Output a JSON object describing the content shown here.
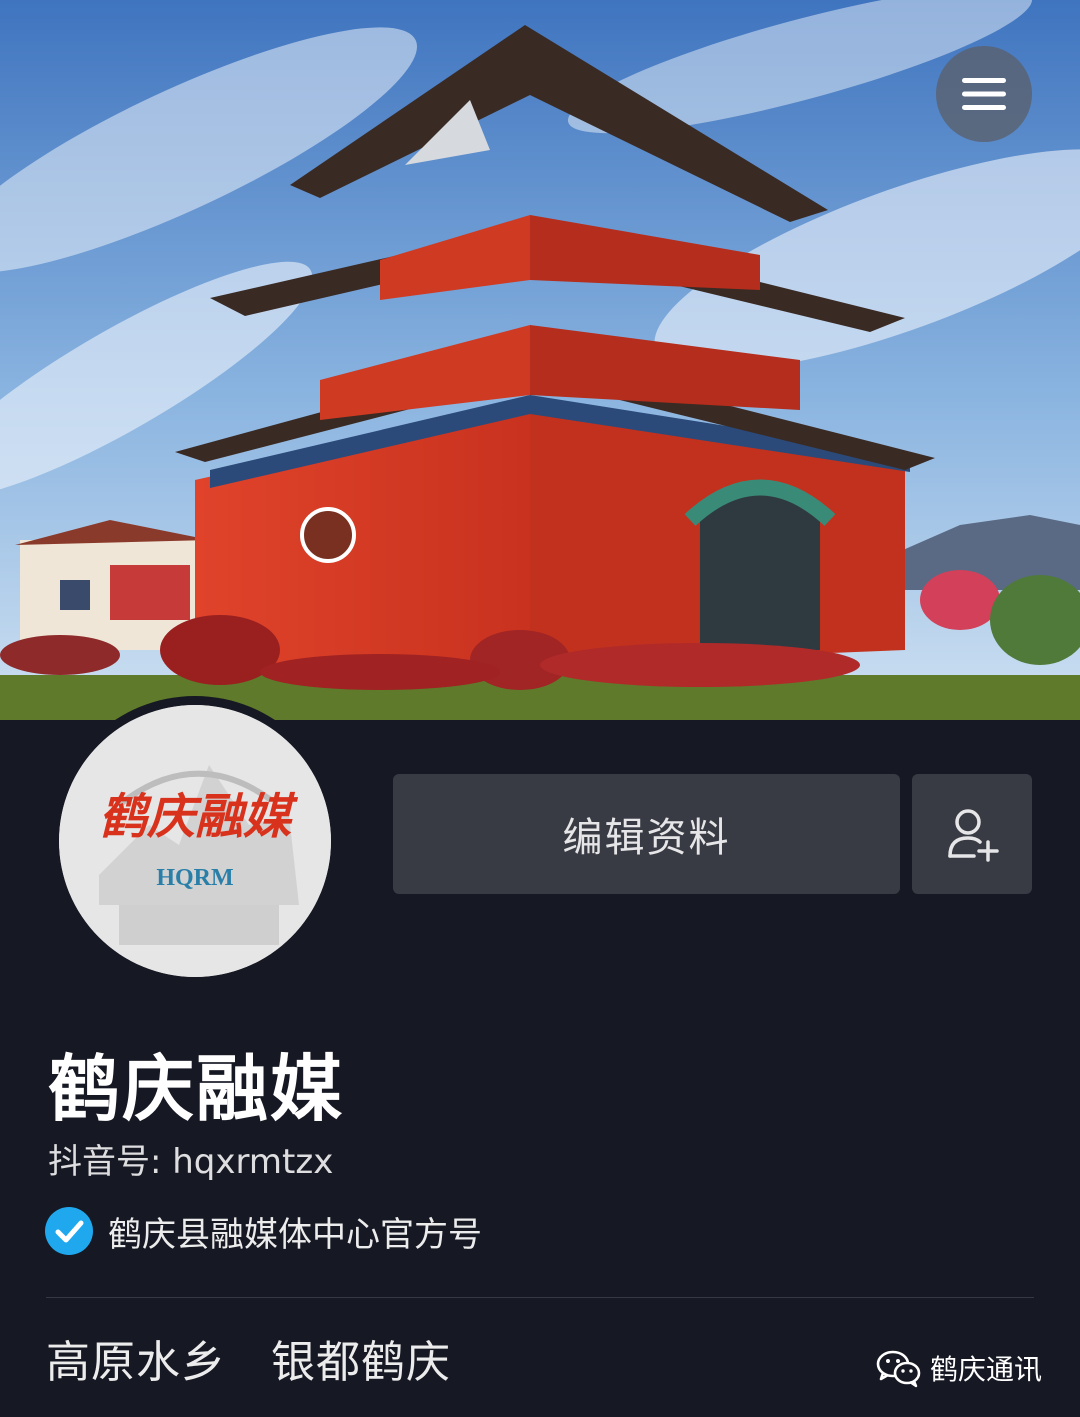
{
  "header": {
    "cover_image": "bell-tower-photo",
    "menu_icon": "hamburger-menu-icon"
  },
  "profile": {
    "avatar_logo_text": "鹤庆融媒",
    "avatar_logo_sub": "HQRM",
    "edit_button_label": "编辑资料",
    "add_friend_icon": "add-friend-icon",
    "name": "鹤庆融媒",
    "douyin_id": "抖音号: hqxrmtzx",
    "verified_text": "鹤庆县融媒体中心官方号",
    "bio": "高原水乡　银都鹤庆"
  },
  "watermark": {
    "icon": "wechat-icon",
    "text": "鹤庆通讯"
  },
  "colors": {
    "background": "#161823",
    "button_bg": "#393b44",
    "verified_blue": "#20a8ef"
  }
}
